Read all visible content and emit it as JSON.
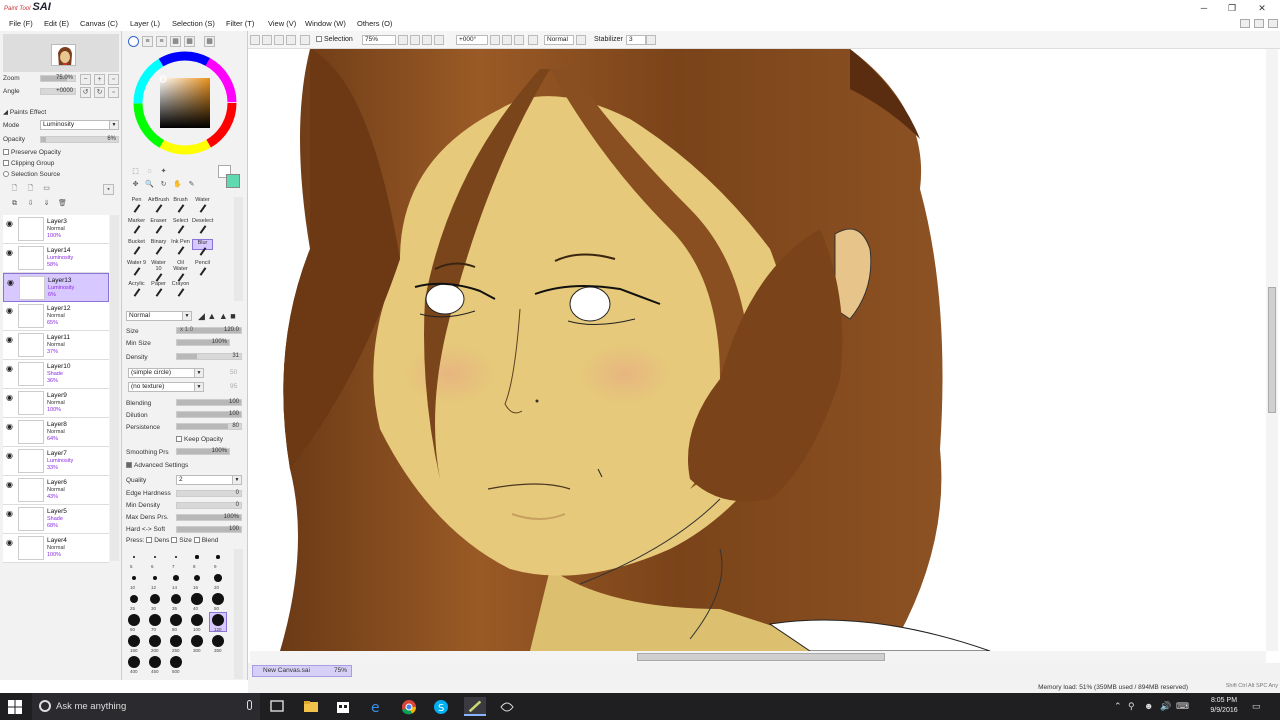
{
  "app": {
    "logo_small": "Paint Tool",
    "logo_big": "SAI",
    "window_controls": {
      "minimize": "─",
      "maximize": "❐",
      "close": "✕"
    }
  },
  "menu": [
    "File (F)",
    "Edit (E)",
    "Canvas (C)",
    "Layer (L)",
    "Selection (S)",
    "Filter (T)",
    "View (V)",
    "Window (W)",
    "Others (O)"
  ],
  "navigator": {
    "zoom_label": "Zoom",
    "zoom_value": "75.0%",
    "angle_label": "Angle",
    "angle_value": "+0000"
  },
  "paint_effect": {
    "header": "Paints Effect",
    "mode_label": "Mode",
    "mode_value": "Luminosity",
    "opacity_label": "Opacity",
    "opacity_value": "6%",
    "opacity_fraction": 0.06,
    "preserve_opacity": "Preserve Opacity",
    "clipping_group": "Clipping Group",
    "selection_source": "Selection Source"
  },
  "layers": [
    {
      "name": "Layer3",
      "mode": "Normal",
      "opacity": "100%",
      "selected": false
    },
    {
      "name": "Layer14",
      "mode": "Luminosity",
      "opacity": "58%",
      "selected": false
    },
    {
      "name": "Layer13",
      "mode": "Luminosity",
      "opacity": "6%",
      "selected": true
    },
    {
      "name": "Layer12",
      "mode": "Normal",
      "opacity": "65%",
      "selected": false
    },
    {
      "name": "Layer11",
      "mode": "Normal",
      "opacity": "37%",
      "selected": false
    },
    {
      "name": "Layer10",
      "mode": "Shade",
      "opacity": "36%",
      "selected": false
    },
    {
      "name": "Layer9",
      "mode": "Normal",
      "opacity": "100%",
      "selected": false
    },
    {
      "name": "Layer8",
      "mode": "Normal",
      "opacity": "64%",
      "selected": false
    },
    {
      "name": "Layer7",
      "mode": "Luminosity",
      "opacity": "33%",
      "selected": false
    },
    {
      "name": "Layer6",
      "mode": "Normal",
      "opacity": "43%",
      "selected": false
    },
    {
      "name": "Layer5",
      "mode": "Shade",
      "opacity": "68%",
      "selected": false
    },
    {
      "name": "Layer4",
      "mode": "Normal",
      "opacity": "100%",
      "selected": false
    }
  ],
  "tools": {
    "row1": [
      "Pen",
      "AirBrush",
      "Brush",
      "Water"
    ],
    "row2": [
      "Marker",
      "Eraser",
      "Select",
      "Deselect"
    ],
    "row3": [
      "Bucket",
      "Binary",
      "Ink Pen",
      "Blur"
    ],
    "row4": [
      "Water 9",
      "Water 10",
      "Oil Water",
      "Pencil"
    ],
    "row5": [
      "Acrylic",
      "Paper",
      "Crayon",
      ""
    ]
  },
  "brush": {
    "blend_mode": "Normal",
    "size_label": "Size",
    "size_mult": "x 1.0",
    "size_value": "120.0",
    "min_size_label": "Min Size",
    "min_size_value": "100%",
    "density_label": "Density",
    "density_value": "31",
    "shape": "(simple circle)",
    "shape_value": "50",
    "texture": "(no texture)",
    "texture_value": "95",
    "blending_label": "Blending",
    "blending_value": "100",
    "dilution_label": "Dilution",
    "dilution_value": "100",
    "persistence_label": "Persistence",
    "persistence_value": "80",
    "keep_opacity": "Keep Opacity",
    "smoothing_label": "Smoothing Prs",
    "smoothing_value": "100%",
    "advanced": "Advanced Settings",
    "quality_label": "Quality",
    "quality_value": "2",
    "edge_label": "Edge Hardness",
    "edge_value": "0",
    "min_density_label": "Min Density",
    "min_density_value": "0",
    "max_dens_label": "Max Dens Prs.",
    "max_dens_value": "100%",
    "hard_soft_label": "Hard <-> Soft",
    "hard_soft_value": "100",
    "press_label": "Press:",
    "dens": "Dens",
    "size": "Size",
    "blend": "Blend"
  },
  "brush_sizes": [
    "5",
    "6",
    "7",
    "8",
    "9",
    "10",
    "12",
    "14",
    "16",
    "20",
    "25",
    "30",
    "35",
    "40",
    "50",
    "60",
    "70",
    "80",
    "100",
    "120",
    "160",
    "200",
    "250",
    "300",
    "350",
    "400",
    "450",
    "500"
  ],
  "canvas_toolbar": {
    "selection_label": "Selection",
    "zoom": "75%",
    "angle": "+000°",
    "blend": "Normal",
    "stabilizer_label": "Stabilizer",
    "stabilizer_value": "3"
  },
  "document_tab": {
    "name": "New Canvas.sai",
    "zoom": "75%"
  },
  "status": {
    "memory": "Memory load: 51% (359MB used / 894MB reserved)",
    "keys": "Shift Ctrl Alt SPC Any"
  },
  "taskbar": {
    "search_placeholder": "Ask me anything",
    "time": "8:05 PM",
    "date": "9/9/2016"
  }
}
